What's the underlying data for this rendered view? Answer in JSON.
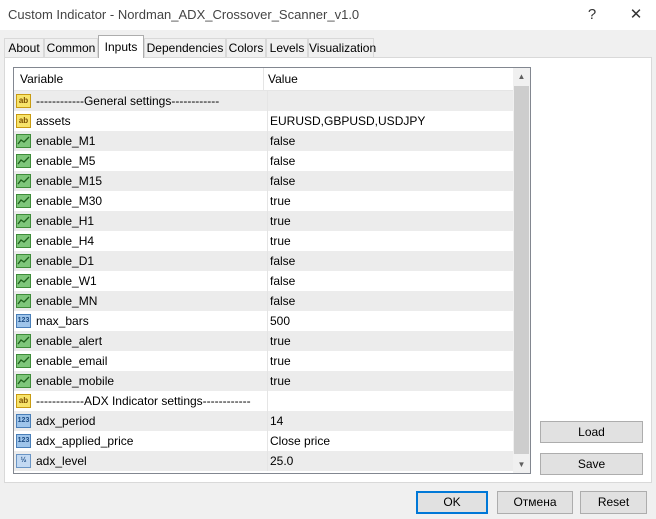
{
  "window": {
    "title": "Custom Indicator - Nordman_ADX_Crossover_Scanner_v1.0",
    "help_label": "?",
    "close_label": "✕"
  },
  "tabs": [
    {
      "label": "About"
    },
    {
      "label": "Common"
    },
    {
      "label": "Inputs",
      "active": true
    },
    {
      "label": "Dependencies"
    },
    {
      "label": "Colors"
    },
    {
      "label": "Levels"
    },
    {
      "label": "Visualization"
    }
  ],
  "grid": {
    "columns": {
      "variable": "Variable",
      "value": "Value"
    },
    "rows": [
      {
        "type": "string",
        "name": "------------General settings------------",
        "value": ""
      },
      {
        "type": "string",
        "name": "assets",
        "value": "EURUSD,GBPUSD,USDJPY"
      },
      {
        "type": "bool",
        "name": "enable_M1",
        "value": "false"
      },
      {
        "type": "bool",
        "name": "enable_M5",
        "value": "false"
      },
      {
        "type": "bool",
        "name": "enable_M15",
        "value": "false"
      },
      {
        "type": "bool",
        "name": "enable_M30",
        "value": "true"
      },
      {
        "type": "bool",
        "name": "enable_H1",
        "value": "true"
      },
      {
        "type": "bool",
        "name": "enable_H4",
        "value": "true"
      },
      {
        "type": "bool",
        "name": "enable_D1",
        "value": "false"
      },
      {
        "type": "bool",
        "name": "enable_W1",
        "value": "false"
      },
      {
        "type": "bool",
        "name": "enable_MN",
        "value": "false"
      },
      {
        "type": "int",
        "name": "max_bars",
        "value": "500"
      },
      {
        "type": "bool",
        "name": "enable_alert",
        "value": "true"
      },
      {
        "type": "bool",
        "name": "enable_email",
        "value": "true"
      },
      {
        "type": "bool",
        "name": "enable_mobile",
        "value": "true"
      },
      {
        "type": "string",
        "name": "------------ADX Indicator settings------------",
        "value": ""
      },
      {
        "type": "int",
        "name": "adx_period",
        "value": "14"
      },
      {
        "type": "int",
        "name": "adx_applied_price",
        "value": "Close price"
      },
      {
        "type": "double",
        "name": "adx_level",
        "value": "25.0"
      }
    ],
    "icons": {
      "string": "ab",
      "int": "123",
      "double": "½"
    }
  },
  "side_buttons": {
    "load": "Load",
    "save": "Save"
  },
  "footer": {
    "ok": "OK",
    "cancel": "Отмена",
    "reset": "Reset"
  }
}
